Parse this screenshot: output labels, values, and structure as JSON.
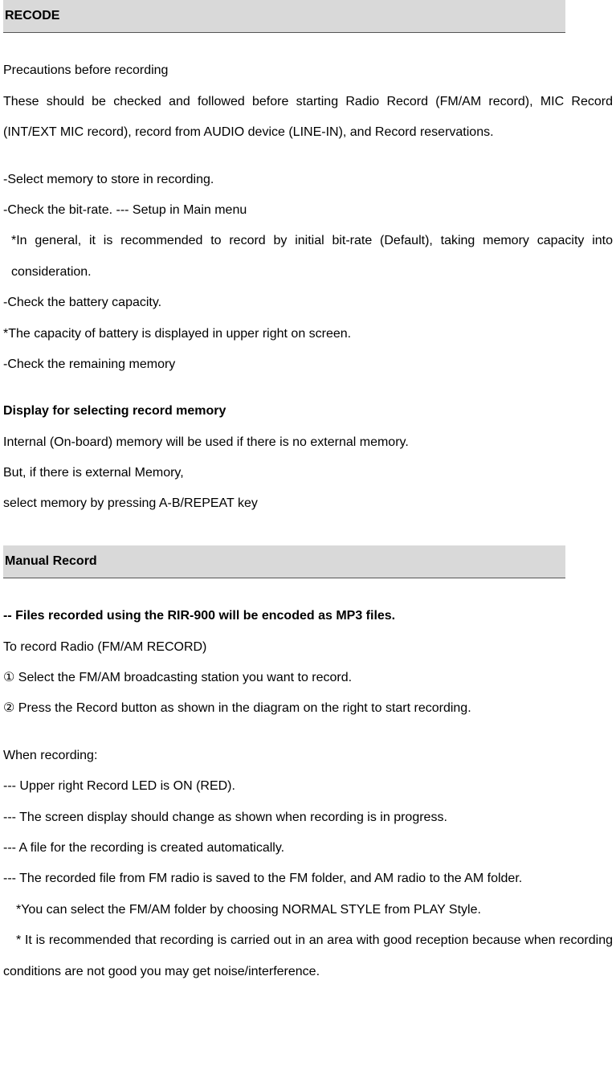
{
  "header1": "RECODE",
  "precautions_title": "Precautions before recording",
  "precautions_body": "These should be checked and followed before starting Radio Record (FM/AM record), MIC Record (INT/EXT MIC record), record from AUDIO device (LINE-IN), and Record reservations.",
  "list1": {
    "a": "-Select memory to store in recording.",
    "b": "-Check the bit-rate. --- Setup in Main menu",
    "b_note": "*In general, it is recommended to record by initial bit-rate (Default), taking memory capacity into consideration.",
    "c": "-Check the battery capacity.",
    "c_note": "*The capacity of battery is displayed in upper right on screen.",
    "d": "-Check the remaining memory"
  },
  "display_title": "Display for selecting record memory",
  "display_body1": "Internal (On-board) memory will be used if there is no external memory.",
  "display_body2": "But, if there is external Memory,",
  "display_body3": "select memory by pressing A-B/REPEAT key",
  "header2": "Manual Record",
  "mp3_line": "-- Files recorded using the RIR-900 will be encoded as MP3 files.",
  "record_radio_title": "To record Radio (FM/AM RECORD)",
  "step1": "①  Select the FM/AM broadcasting station you want to record.",
  "step2": "②  Press the Record button as shown in the diagram on the right to start recording.",
  "when_recording": "When recording:",
  "wr1": "--- Upper right Record LED is ON (RED).",
  "wr2": "--- The screen display should change as shown when recording is in progress.",
  "wr3": "--- A file for the recording is created automatically.",
  "wr4": "--- The recorded file from FM radio is saved to the FM folder, and AM radio to the AM folder.",
  "wr_note1": "*You can select the FM/AM folder by choosing NORMAL STYLE from PLAY Style.",
  "wr_note2": "* It is recommended that recording is carried out in an area with good reception because when recording conditions are not good you may get noise/interference."
}
